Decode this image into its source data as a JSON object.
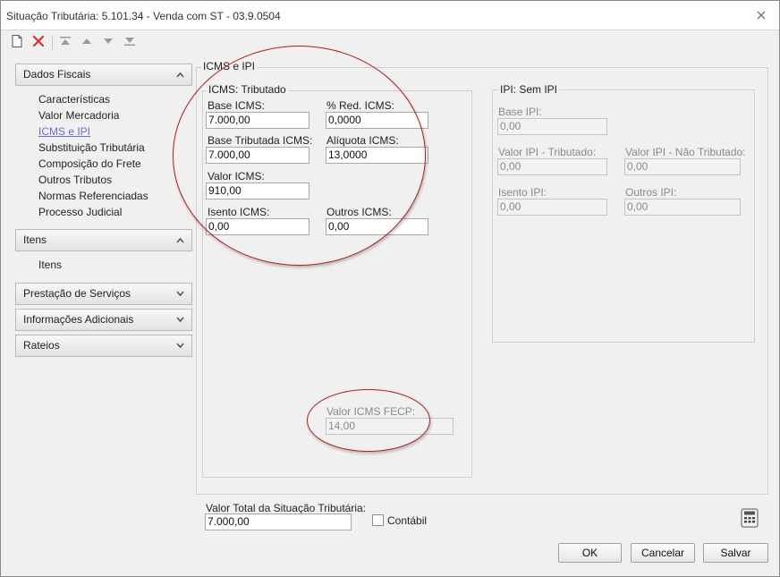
{
  "window": {
    "title": "Situação Tributária: 5.101.34 - Venda com ST - 03.9.0504"
  },
  "sidebar": {
    "groups": [
      {
        "label": "Dados Fiscais",
        "expanded": true,
        "items": [
          "Características",
          "Valor Mercadoria",
          "ICMS e IPI",
          "Substituição Tributária",
          "Composição do Frete",
          "Outros Tributos",
          "Normas Referenciadas",
          "Processo Judicial"
        ]
      },
      {
        "label": "Itens",
        "expanded": true,
        "items": [
          "Itens"
        ]
      },
      {
        "label": "Prestação de Serviços",
        "expanded": false
      },
      {
        "label": "Informações Adicionais",
        "expanded": false
      },
      {
        "label": "Rateios",
        "expanded": false
      }
    ],
    "active_item": "ICMS e IPI"
  },
  "main": {
    "section_title": "ICMS e IPI",
    "icms": {
      "legend": "ICMS: Tributado",
      "base_icms": {
        "label": "Base ICMS:",
        "value": "7.000,00"
      },
      "red_icms": {
        "label": "% Red. ICMS:",
        "value": "0,0000"
      },
      "base_tributada": {
        "label": "Base Tributada ICMS:",
        "value": "7.000,00"
      },
      "aliquota": {
        "label": "Alíquota ICMS:",
        "value": "13,0000"
      },
      "valor_icms": {
        "label": "Valor ICMS:",
        "value": "910,00"
      },
      "isento": {
        "label": "Isento ICMS:",
        "value": "0,00"
      },
      "outros": {
        "label": "Outros ICMS:",
        "value": "0,00"
      },
      "fecp": {
        "label": "Valor ICMS FECP:",
        "value": "14,00"
      }
    },
    "ipi": {
      "legend": "IPI: Sem IPI",
      "base_ipi": {
        "label": "Base IPI:",
        "value": "0,00"
      },
      "valor_tributado": {
        "label": "Valor IPI - Tributado:",
        "value": "0,00"
      },
      "valor_nao_tributado": {
        "label": "Valor IPI - Não Tributado:",
        "value": "0,00"
      },
      "isento": {
        "label": "Isento IPI:",
        "value": "0,00"
      },
      "outros": {
        "label": "Outros IPI:",
        "value": "0,00"
      }
    }
  },
  "footer": {
    "total_label": "Valor Total da Situação Tributária:",
    "total_value": "7.000,00",
    "contabil_label": "Contábil",
    "contabil_checked": false,
    "ok_label": "OK",
    "cancel_label": "Cancelar",
    "save_label": "Salvar"
  },
  "colors": {
    "annotation_red": "#b01e1e",
    "active_link": "#6a6ad0",
    "delete_red": "#d9302c"
  }
}
